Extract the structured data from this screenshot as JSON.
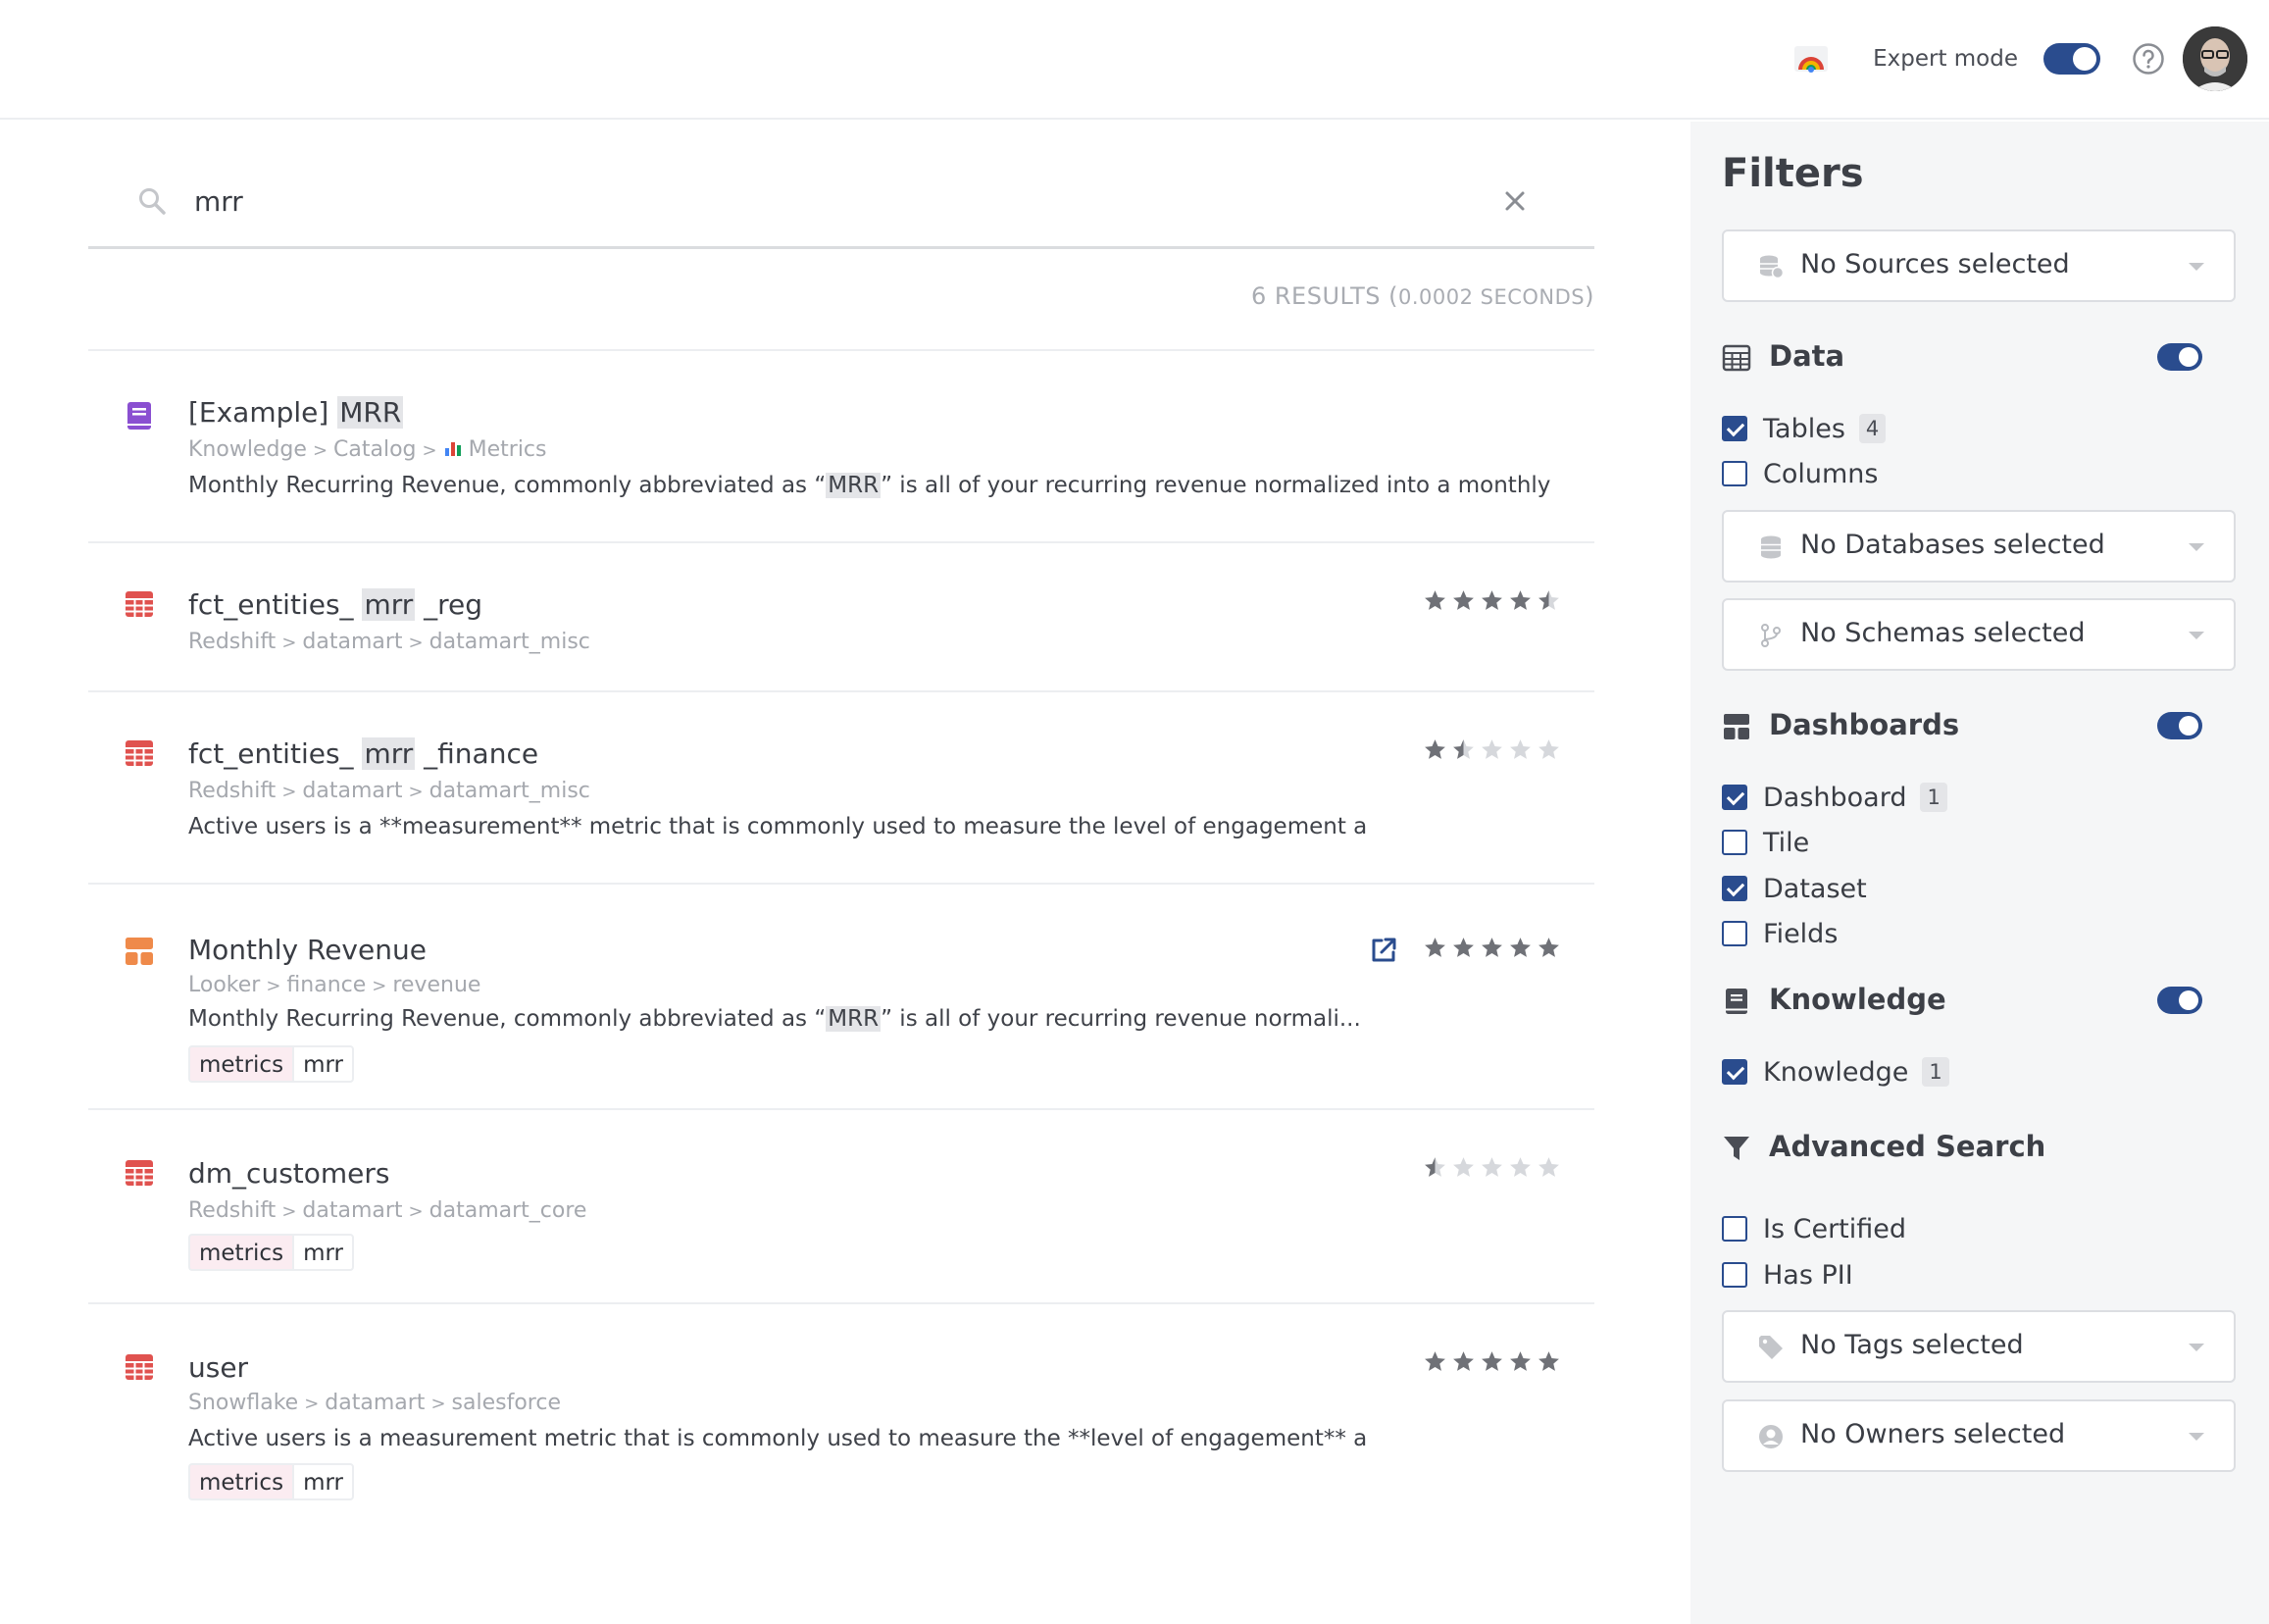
{
  "topbar": {
    "expert_mode_label": "Expert mode",
    "expert_mode_on": true
  },
  "search": {
    "query": "mrr",
    "results_count": "6 RESULTS (",
    "results_time": "0.0002 SECONDS",
    "results_close": ")"
  },
  "results": [
    {
      "icon": "book-icon",
      "icon_color": "#8a4fd1",
      "title_pre": "[Example] ",
      "title_hl": "MRR",
      "title_post": "",
      "path": [
        "Knowledge",
        "Catalog",
        "Metrics"
      ],
      "desc_pre": "Monthly Recurring Revenue, commonly abbreviated as “",
      "desc_hl": "MRR",
      "desc_post": "” is all of your recurring revenue normalized into a monthly",
      "rating": null,
      "tags": []
    },
    {
      "icon": "table-icon",
      "icon_color": "#e0524f",
      "title_pre": "fct_entities_ ",
      "title_hl": "mrr",
      "title_post": " _reg",
      "path": [
        "Redshift",
        "datamart",
        "datamart_misc"
      ],
      "desc_pre": "",
      "desc_hl": "",
      "desc_post": "",
      "rating": 4.5,
      "tags": []
    },
    {
      "icon": "table-icon",
      "icon_color": "#e0524f",
      "title_pre": "fct_entities_ ",
      "title_hl": "mrr",
      "title_post": " _finance",
      "path": [
        "Redshift",
        "datamart",
        "datamart_misc"
      ],
      "desc_pre": "Active users is a **measurement** metric that is commonly used to measure the level of engagement a",
      "desc_hl": "",
      "desc_post": "",
      "rating": 1.5,
      "tags": []
    },
    {
      "icon": "dashboard-icon",
      "icon_color": "#ef8a4a",
      "title_pre": "Monthly Revenue",
      "title_hl": "",
      "title_post": "",
      "path": [
        "Looker",
        "finance",
        "revenue"
      ],
      "desc_pre": "Monthly Recurring Revenue, commonly abbreviated as “",
      "desc_hl": "MRR",
      "desc_post": "” is all of your recurring revenue normali...",
      "rating": 5,
      "external_link": true,
      "tags": [
        "metrics",
        "mrr"
      ]
    },
    {
      "icon": "table-icon",
      "icon_color": "#e0524f",
      "title_pre": "dm_customers",
      "title_hl": "",
      "title_post": "",
      "path": [
        "Redshift",
        "datamart",
        "datamart_core"
      ],
      "desc_pre": "",
      "desc_hl": "",
      "desc_post": "",
      "rating": 0.5,
      "tags": [
        "metrics",
        "mrr"
      ]
    },
    {
      "icon": "table-icon",
      "icon_color": "#e0524f",
      "title_pre": "user",
      "title_hl": "",
      "title_post": "",
      "path": [
        "Snowflake",
        "datamart",
        "salesforce"
      ],
      "desc_pre": "Active users is a measurement metric that is commonly used to measure the **level of engagement** a",
      "desc_hl": "",
      "desc_post": "",
      "rating": 5,
      "tags": [
        "metrics",
        "mrr"
      ]
    }
  ],
  "filters": {
    "title": "Filters",
    "sources": "No Sources selected",
    "data": {
      "label": "Data",
      "enabled": true,
      "tables": {
        "label": "Tables",
        "count": "4",
        "checked": true
      },
      "columns": {
        "label": "Columns",
        "checked": false
      },
      "databases": "No Databases selected",
      "schemas": "No Schemas selected"
    },
    "dashboards": {
      "label": "Dashboards",
      "enabled": true,
      "dashboard": {
        "label": "Dashboard",
        "count": "1",
        "checked": true
      },
      "tile": {
        "label": "Tile",
        "checked": false
      },
      "dataset": {
        "label": "Dataset",
        "checked": true
      },
      "fields": {
        "label": "Fields",
        "checked": false
      }
    },
    "knowledge": {
      "label": "Knowledge",
      "enabled": true,
      "knowledge": {
        "label": "Knowledge",
        "count": "1",
        "checked": true
      }
    },
    "advanced": {
      "label": "Advanced Search",
      "certified": {
        "label": "Is Certified",
        "checked": false
      },
      "pii": {
        "label": "Has PII",
        "checked": false
      },
      "tags": "No Tags selected",
      "owners": "No Owners selected"
    }
  },
  "colors": {
    "accent": "#2a4c8e",
    "star_on": "#6f7177",
    "star_off": "#d6d8dc",
    "tag_bg": "#fbecf1"
  }
}
